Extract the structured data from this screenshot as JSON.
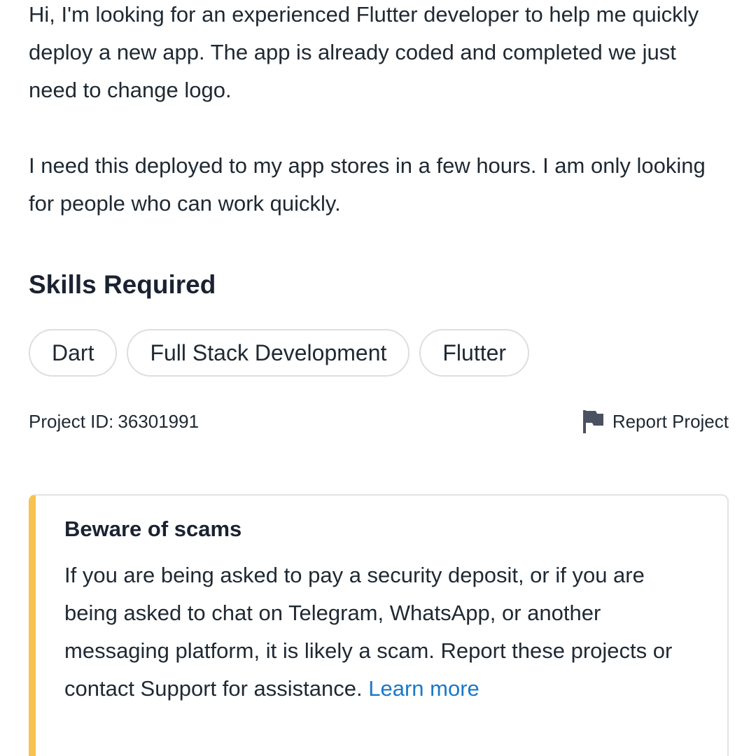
{
  "description": {
    "paragraph_1": "Hi, I'm looking for an experienced Flutter developer to help me quickly deploy a new app. The app is already coded and completed we just need to change logo.",
    "paragraph_2": "I need this deployed to my app stores in a few hours. I am only looking for people who can work quickly."
  },
  "skills": {
    "title": "Skills Required",
    "items": [
      "Dart",
      "Full Stack Development",
      "Flutter"
    ]
  },
  "meta": {
    "project_id_label": "Project ID:",
    "project_id": "36301991",
    "report_label": "Report Project",
    "report_icon": "flag-icon"
  },
  "alert": {
    "title": "Beware of scams",
    "body": "If you are being asked to pay a security deposit, or if you are being asked to chat on Telegram, WhatsApp, or another messaging platform, it is likely a scam. Report these projects or contact Support for assistance.",
    "link_label": "Learn more",
    "accent_color": "#f7c250",
    "link_color": "#1a78c8"
  }
}
